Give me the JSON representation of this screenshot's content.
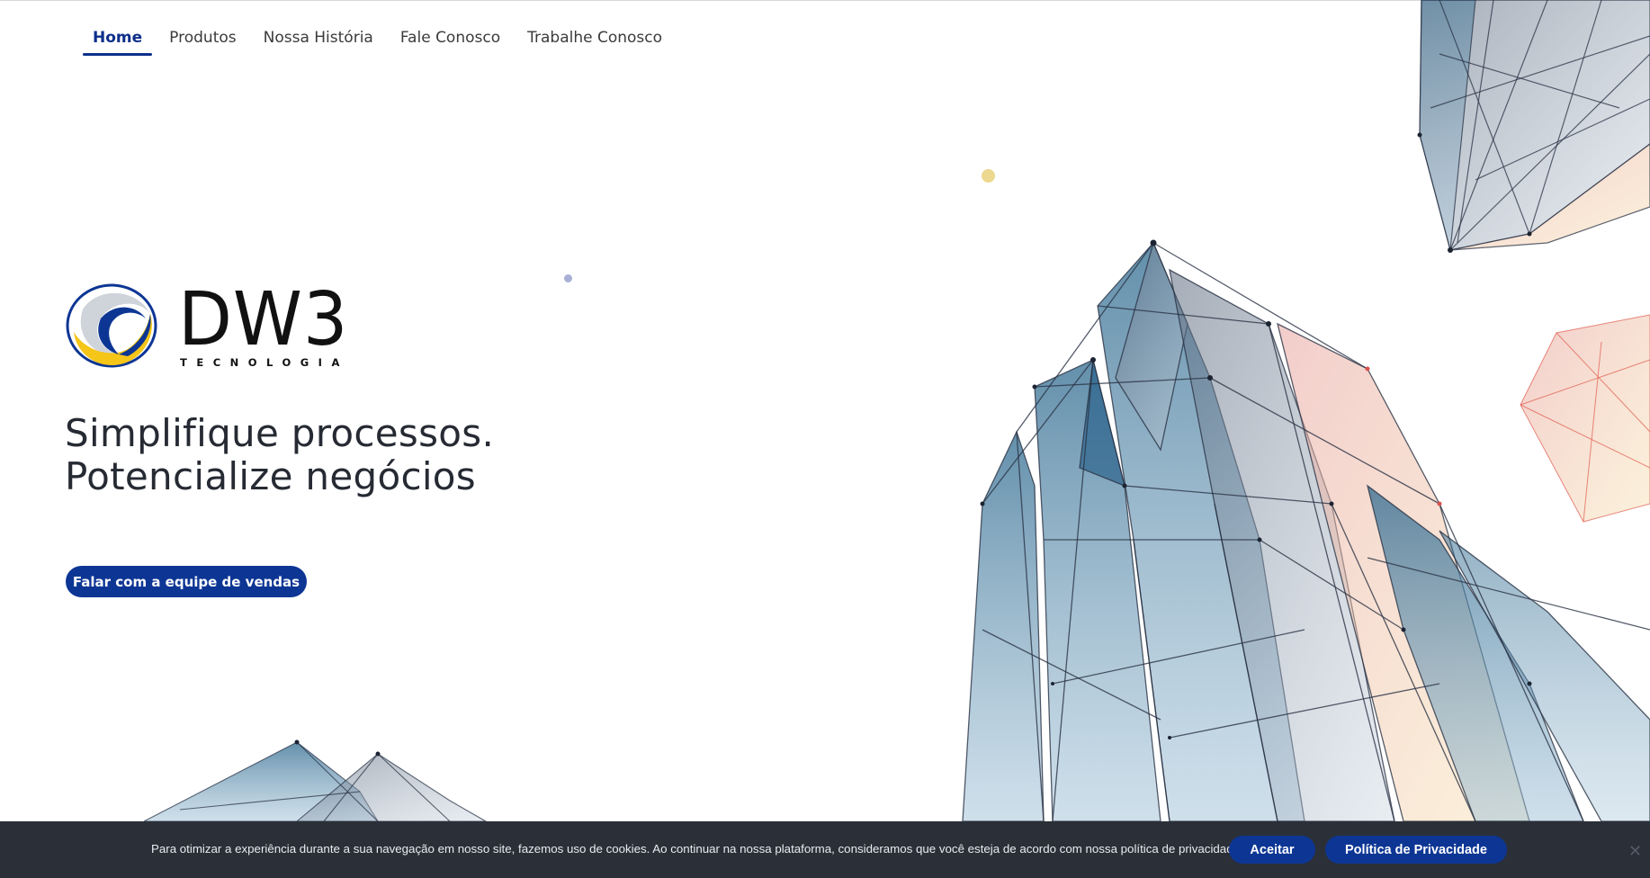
{
  "nav": {
    "items": [
      {
        "label": "Home",
        "active": true
      },
      {
        "label": "Produtos",
        "active": false
      },
      {
        "label": "Nossa História",
        "active": false
      },
      {
        "label": "Fale Conosco",
        "active": false
      },
      {
        "label": "Trabalhe Conosco",
        "active": false
      }
    ]
  },
  "logo": {
    "name": "DW3",
    "subtitle": "TECNOLOGIA"
  },
  "hero": {
    "headline_line1": "Simplifique processos.",
    "headline_line2": "Potencialize negócios",
    "cta_label": "Falar com a equipe de vendas"
  },
  "cookie": {
    "text": "Para otimizar a experiência durante a sua navegação em nosso site, fazemos uso de cookies. Ao continuar na nossa plataforma, consideramos que você esteja de acordo com nossa política de privacidade.",
    "accept_label": "Aceitar",
    "policy_label": "Política de Privacidade",
    "close_icon": "close-icon"
  },
  "colors": {
    "brand_blue": "#0d3694",
    "brand_yellow": "#f5c518",
    "cookie_bg": "#2b2f38"
  }
}
